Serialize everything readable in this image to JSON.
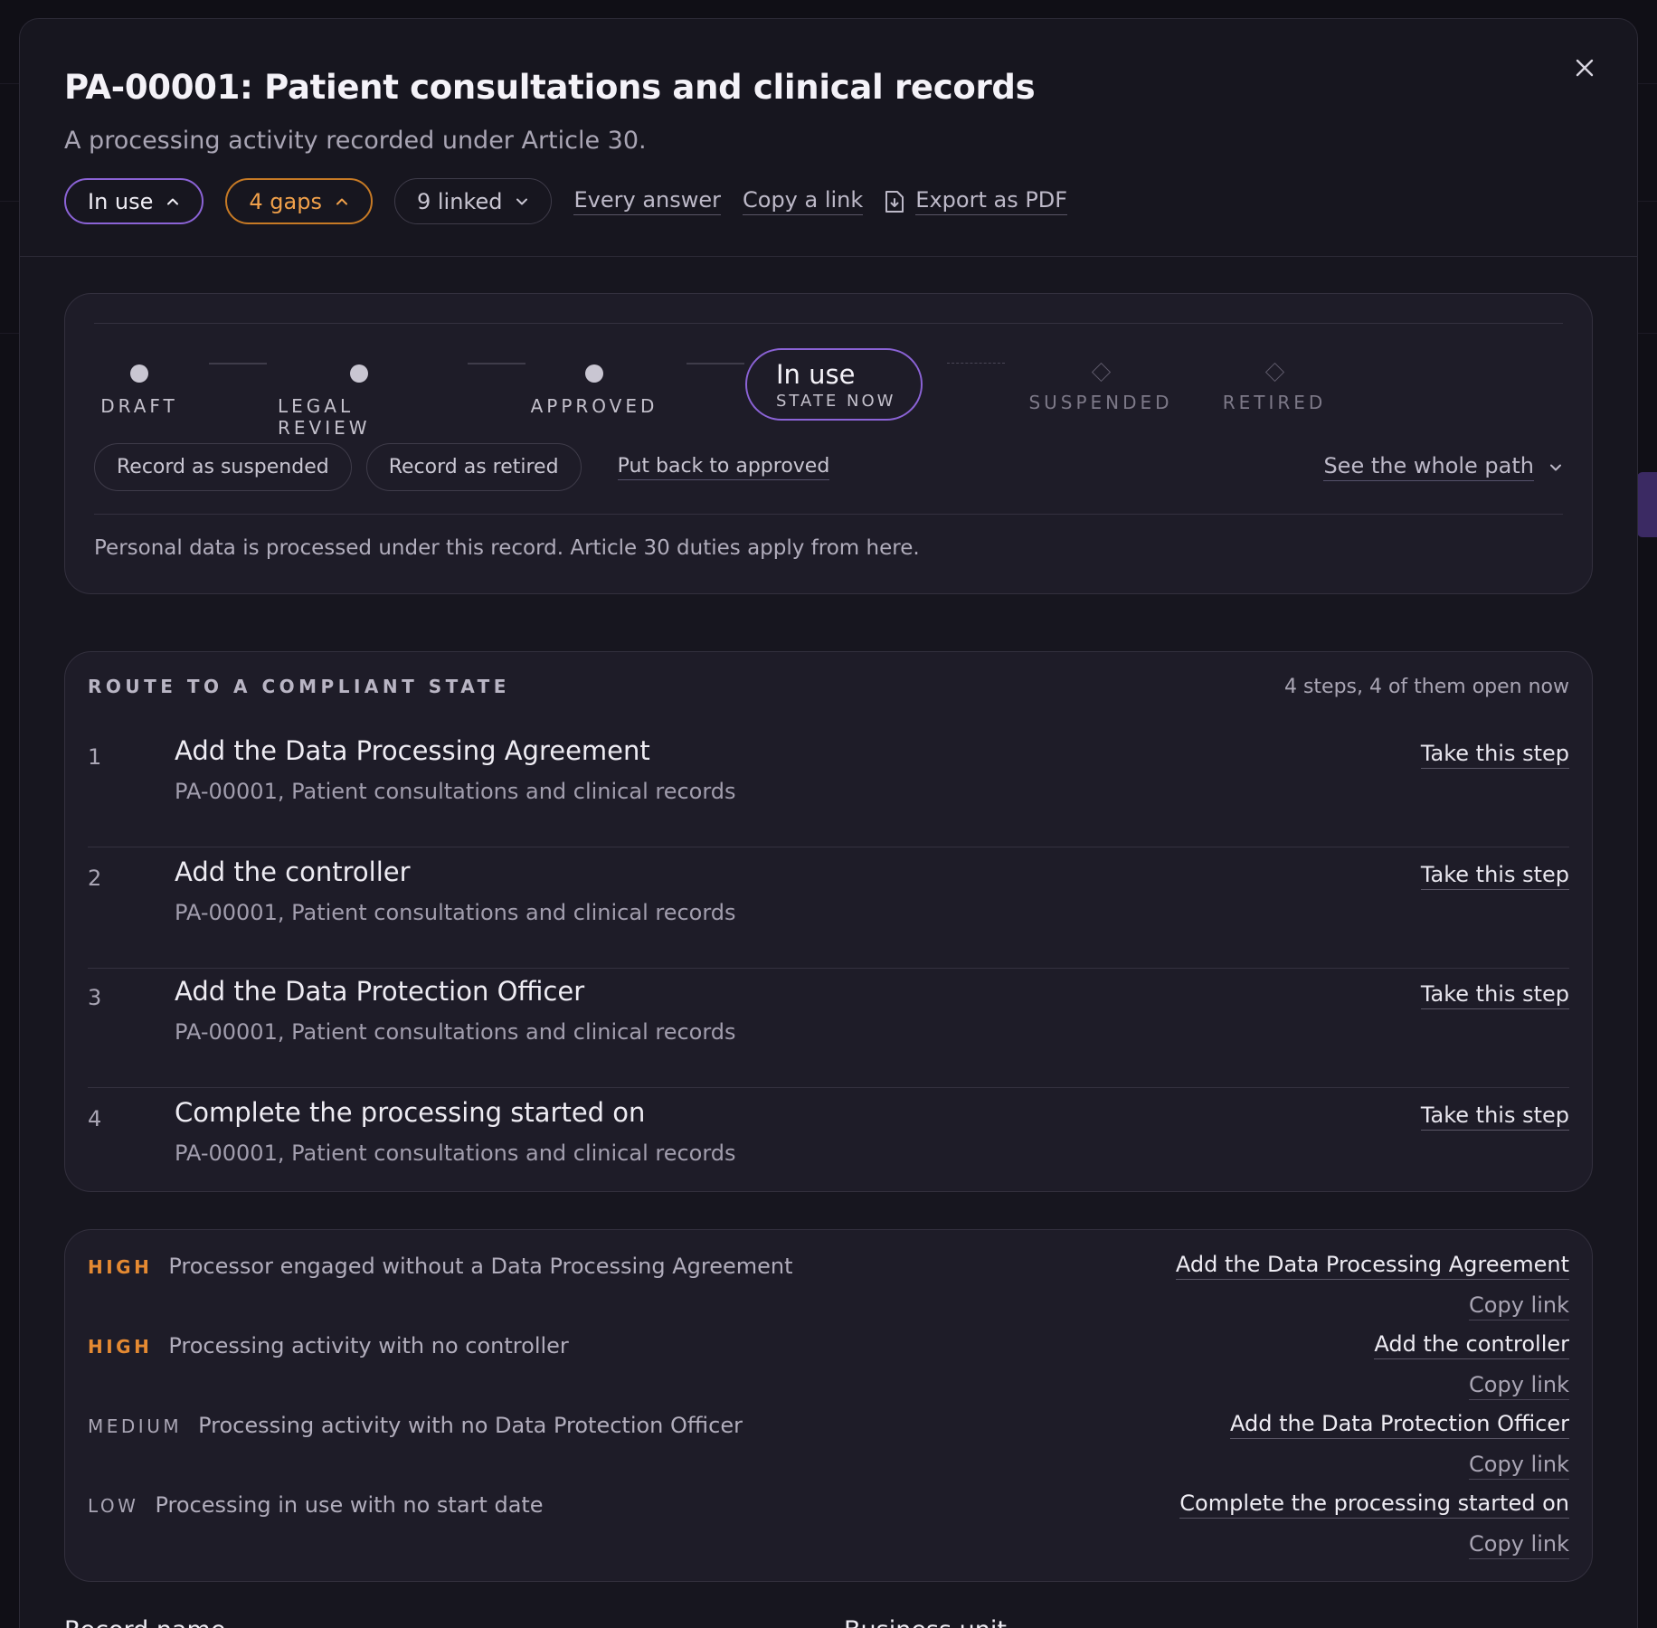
{
  "modal": {
    "title": "PA-00001: Patient consultations and clinical records",
    "subtitle": "A processing activity recorded under Article 30.",
    "status_pill": "In use",
    "gaps_pill": "4 gaps",
    "linked_pill": "9 linked",
    "every_answer": "Every answer",
    "copy_link": "Copy a link",
    "export_pdf": "Export as PDF"
  },
  "lifecycle": {
    "stages": [
      "DRAFT",
      "LEGAL REVIEW",
      "APPROVED"
    ],
    "current_name": "In use",
    "current_sub": "STATE NOW",
    "future": [
      "SUSPENDED",
      "RETIRED"
    ],
    "actions": [
      "Record as suspended",
      "Record as retired"
    ],
    "put_back": "Put back to approved",
    "see_path": "See the whole path",
    "note": "Personal data is processed under this record. Article 30 duties apply from here."
  },
  "route": {
    "title": "ROUTE TO A COMPLIANT STATE",
    "count": "4 steps, 4 of them open now",
    "take_label": "Take this step",
    "steps": [
      {
        "num": "1",
        "title": "Add the Data Processing Agreement",
        "desc": "PA-00001, Patient consultations and clinical records"
      },
      {
        "num": "2",
        "title": "Add the controller",
        "desc": "PA-00001, Patient consultations and clinical records"
      },
      {
        "num": "3",
        "title": "Add the Data Protection Officer",
        "desc": "PA-00001, Patient consultations and clinical records"
      },
      {
        "num": "4",
        "title": "Complete the processing started on",
        "desc": "PA-00001, Patient consultations and clinical records"
      }
    ]
  },
  "gaps": {
    "copy_label": "Copy link",
    "items": [
      {
        "severity": "HIGH",
        "text": "Processor engaged without a Data Processing Agreement",
        "fix": "Add the Data Processing Agreement"
      },
      {
        "severity": "HIGH",
        "text": "Processing activity with no controller",
        "fix": "Add the controller"
      },
      {
        "severity": "MEDIUM",
        "text": "Processing activity with no Data Protection Officer",
        "fix": "Add the Data Protection Officer"
      },
      {
        "severity": "LOW",
        "text": "Processing in use with no start date",
        "fix": "Complete the processing started on"
      }
    ]
  },
  "fields": {
    "record_name": "Record name",
    "business_unit": "Business unit"
  },
  "colors": {
    "accent": "#8b63d6",
    "warning": "#e58a32",
    "surface": "#1e1c28"
  }
}
